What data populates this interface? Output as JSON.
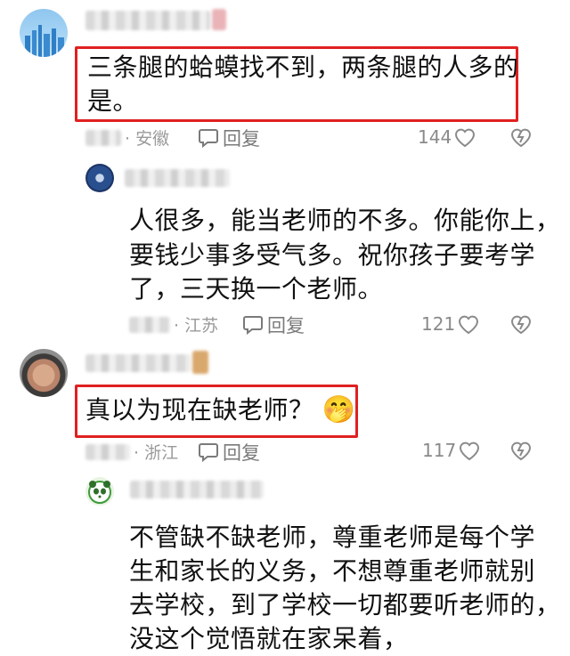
{
  "comments": [
    {
      "text": "三条腿的蛤蟆找不到，两条腿的人多的是。",
      "line1": "三条腿的蛤蟆找不到，两条腿的人多的",
      "line2": "是。",
      "location": "· 安徽",
      "reply_label": "回复",
      "likes": "144",
      "highlighted": true
    },
    {
      "line1": "人很多，能当老师的不多。你能你上，",
      "line2": "要钱少事多受气多。祝你孩子要考学",
      "line3": "了，三天换一个老师。",
      "location": "· 江苏",
      "reply_label": "回复",
      "likes": "121",
      "highlighted": false
    },
    {
      "text": "真以为现在缺老师？",
      "emoji": "🤭",
      "location": "· 浙江",
      "reply_label": "回复",
      "likes": "117",
      "highlighted": true
    },
    {
      "line1": "不管缺不缺老师，尊重老师是每个学",
      "line2": "生和家长的义务，不想尊重老师就别",
      "line3": "去学校，到了学校一切都要听老师的，",
      "line4": "没这个觉悟就在家呆着，",
      "highlighted": false
    }
  ],
  "colors": {
    "highlight_border": "#e02020",
    "meta_text": "#9a9a9a"
  },
  "icons": [
    "reply-bubble-icon",
    "heart-outline-icon",
    "broken-heart-icon"
  ]
}
